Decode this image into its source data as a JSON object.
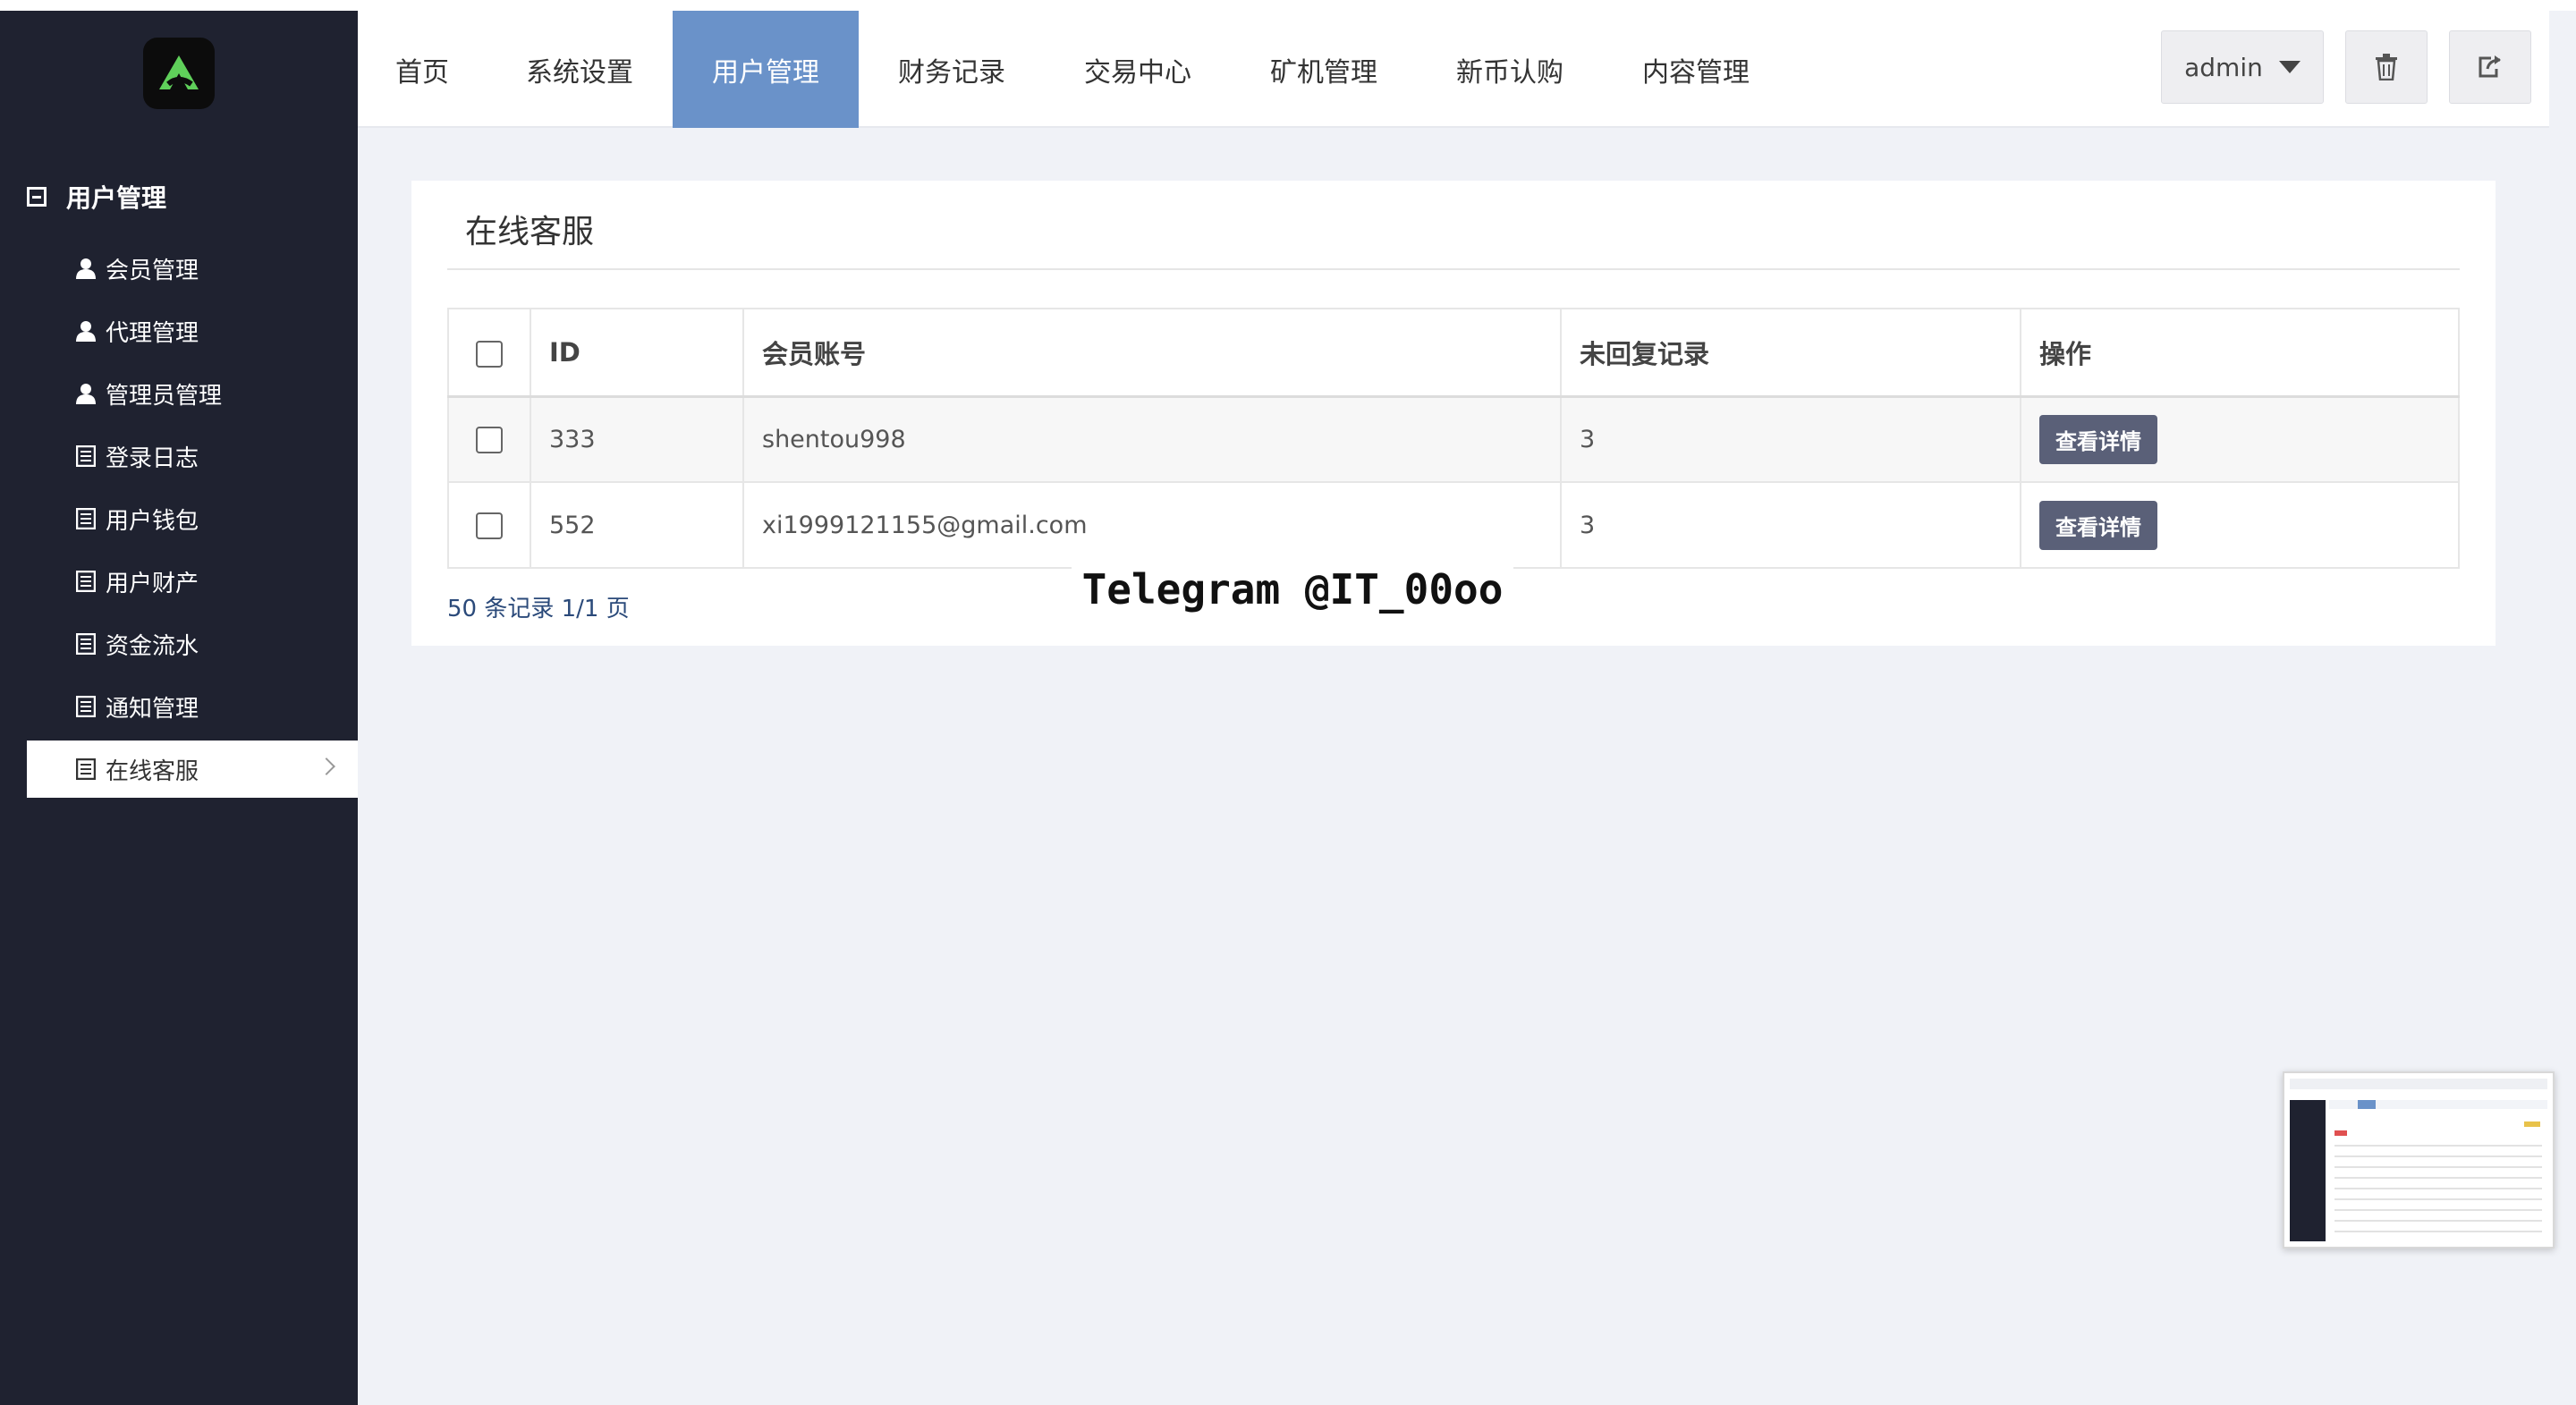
{
  "sidebar": {
    "group_title": "用户管理",
    "items": [
      {
        "label": "会员管理",
        "icon": "user-icon"
      },
      {
        "label": "代理管理",
        "icon": "user-icon"
      },
      {
        "label": "管理员管理",
        "icon": "user-icon"
      },
      {
        "label": "登录日志",
        "icon": "list-icon"
      },
      {
        "label": "用户钱包",
        "icon": "list-icon"
      },
      {
        "label": "用户财产",
        "icon": "list-icon"
      },
      {
        "label": "资金流水",
        "icon": "list-icon"
      },
      {
        "label": "通知管理",
        "icon": "list-icon"
      },
      {
        "label": "在线客服",
        "icon": "list-icon",
        "active": true
      }
    ]
  },
  "header": {
    "nav": [
      {
        "label": "首页"
      },
      {
        "label": "系统设置"
      },
      {
        "label": "用户管理",
        "active": true
      },
      {
        "label": "财务记录"
      },
      {
        "label": "交易中心"
      },
      {
        "label": "矿机管理"
      },
      {
        "label": "新币认购"
      },
      {
        "label": "内容管理"
      }
    ],
    "user": "admin",
    "icons": [
      "trash-icon",
      "logout-icon"
    ]
  },
  "panel": {
    "title": "在线客服",
    "table": {
      "headers": [
        "ID",
        "会员账号",
        "未回复记录",
        "操作"
      ],
      "rows": [
        {
          "id": "333",
          "account": "shentou998",
          "unreplied": "3",
          "action": "查看详情"
        },
        {
          "id": "552",
          "account": "xi1999121155@gmail.com",
          "unreplied": "3",
          "action": "查看详情"
        }
      ]
    },
    "pagination": "50 条记录 1/1 页"
  },
  "overlay": {
    "watermark": "Telegram @IT_00oo"
  },
  "colors": {
    "sidebar_bg": "#1f2230",
    "nav_active": "#6a92c9",
    "button_dark": "#5a6078",
    "page_bg": "#f0f2f7"
  }
}
